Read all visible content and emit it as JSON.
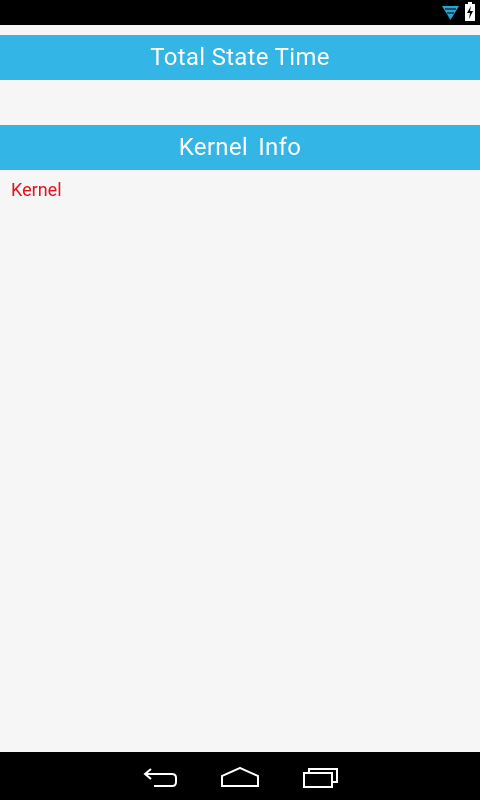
{
  "status_bar": {
    "icons": [
      "wifi-icon",
      "battery-charging-icon"
    ]
  },
  "sections": {
    "total_state_time": {
      "title": "Total State Time"
    },
    "kernel_info": {
      "title": "Kernel  Info"
    }
  },
  "kernel": {
    "label": "Kernel"
  },
  "navigation": {
    "buttons": [
      "back-icon",
      "home-icon",
      "recent-apps-icon"
    ]
  },
  "colors": {
    "header_bg": "#33b5e5",
    "header_text": "#ffffff",
    "kernel_text": "#e3121e",
    "background": "#f6f6f6"
  }
}
